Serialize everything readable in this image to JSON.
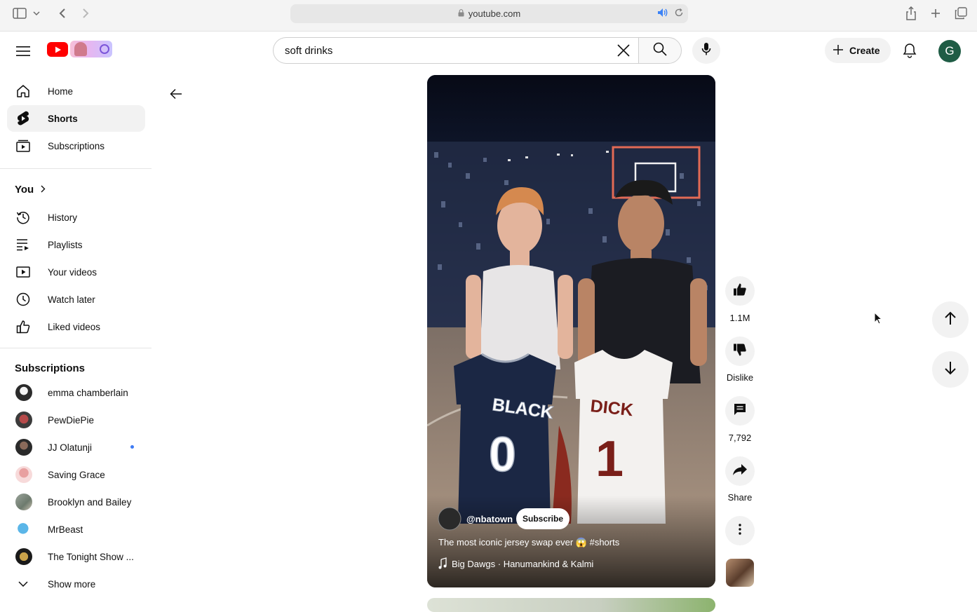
{
  "browser": {
    "url": "youtube.com"
  },
  "header": {
    "search_query": "soft drinks",
    "create_label": "Create",
    "avatar_letter": "G"
  },
  "sidebar": {
    "main_items": [
      {
        "label": "Home",
        "icon": "home-icon"
      },
      {
        "label": "Shorts",
        "icon": "shorts-icon",
        "active": true
      },
      {
        "label": "Subscriptions",
        "icon": "subscriptions-icon"
      }
    ],
    "you_heading": "You",
    "you_items": [
      {
        "label": "History",
        "icon": "history-icon"
      },
      {
        "label": "Playlists",
        "icon": "playlists-icon"
      },
      {
        "label": "Your videos",
        "icon": "your-videos-icon"
      },
      {
        "label": "Watch later",
        "icon": "watch-later-icon"
      },
      {
        "label": "Liked videos",
        "icon": "liked-videos-icon"
      }
    ],
    "subscriptions_heading": "Subscriptions",
    "subscriptions": [
      {
        "label": "emma chamberlain"
      },
      {
        "label": "PewDiePie"
      },
      {
        "label": "JJ Olatunji",
        "new": true
      },
      {
        "label": "Saving Grace"
      },
      {
        "label": "Brooklyn and Bailey"
      },
      {
        "label": "MrBeast"
      },
      {
        "label": "The Tonight Show ..."
      }
    ],
    "show_more": "Show more"
  },
  "short": {
    "channel": "@nbatown",
    "subscribe_label": "Subscribe",
    "title": "The most iconic jersey swap ever 😱 #shorts",
    "audio": "Big Dawgs · Hanumankind & Kalmi",
    "jersey_left_name": "BLACK",
    "jersey_left_number": "0",
    "jersey_right_name": "DICK",
    "jersey_right_number": "1"
  },
  "actions": {
    "likes": "1.1M",
    "dislike_label": "Dislike",
    "comments": "7,792",
    "share_label": "Share"
  },
  "colors": {
    "youtube_red": "#ff0000",
    "avatar_bg": "#1f5c45",
    "new_dot": "#3e7bf4"
  }
}
